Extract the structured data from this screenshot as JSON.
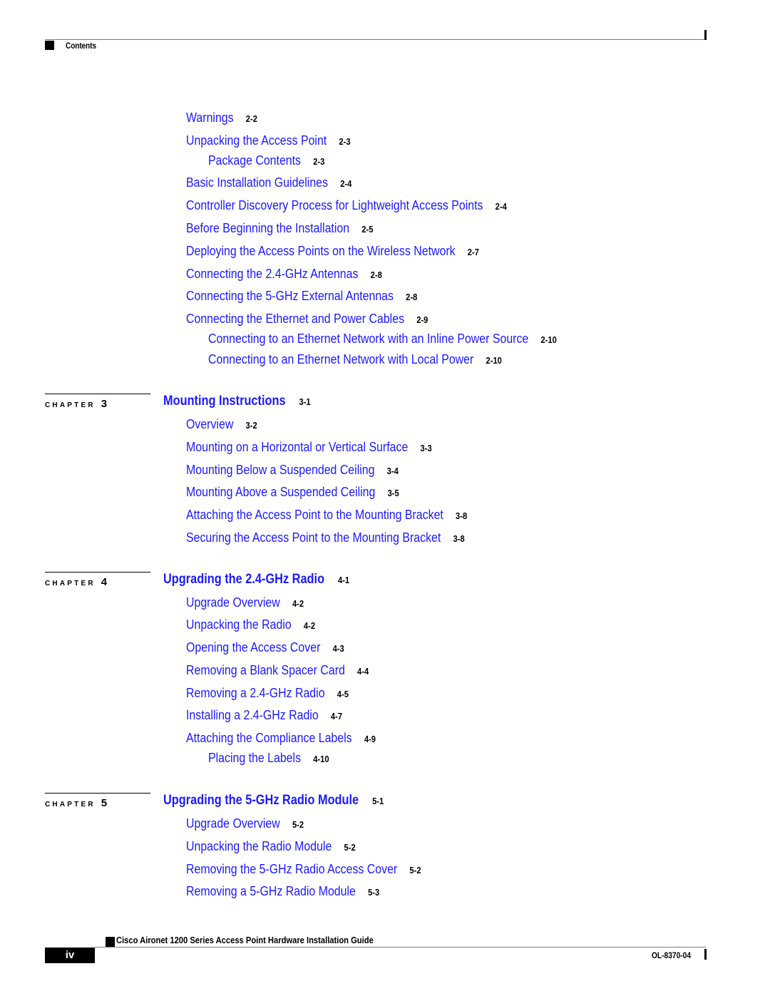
{
  "header": {
    "label": "Contents"
  },
  "toc": {
    "chapter2_cont": [
      {
        "title": "Warnings",
        "page": "2-2",
        "level": 1
      },
      {
        "title": "Unpacking the Access Point",
        "page": "2-3",
        "level": 1
      },
      {
        "title": "Package Contents",
        "page": "2-3",
        "level": 2
      },
      {
        "title": "Basic Installation Guidelines",
        "page": "2-4",
        "level": 1
      },
      {
        "title": "Controller Discovery Process for Lightweight Access Points",
        "page": "2-4",
        "level": 1
      },
      {
        "title": "Before Beginning the Installation",
        "page": "2-5",
        "level": 1
      },
      {
        "title": "Deploying the Access Points on the Wireless Network",
        "page": "2-7",
        "level": 1
      },
      {
        "title": "Connecting the 2.4-GHz Antennas",
        "page": "2-8",
        "level": 1
      },
      {
        "title": "Connecting the 5-GHz External Antennas",
        "page": "2-8",
        "level": 1
      },
      {
        "title": "Connecting the Ethernet and Power Cables",
        "page": "2-9",
        "level": 1
      },
      {
        "title": "Connecting to an Ethernet Network with an Inline Power Source",
        "page": "2-10",
        "level": 2
      },
      {
        "title": "Connecting to an Ethernet Network with Local Power",
        "page": "2-10",
        "level": 2
      }
    ],
    "chapters": [
      {
        "label": "CHAPTER",
        "number": "3",
        "title": "Mounting Instructions",
        "page": "3-1",
        "entries": [
          {
            "title": "Overview",
            "page": "3-2",
            "level": 1
          },
          {
            "title": "Mounting on a Horizontal or Vertical Surface",
            "page": "3-3",
            "level": 1
          },
          {
            "title": "Mounting Below a Suspended Ceiling",
            "page": "3-4",
            "level": 1
          },
          {
            "title": "Mounting Above a Suspended Ceiling",
            "page": "3-5",
            "level": 1
          },
          {
            "title": "Attaching the Access Point to the Mounting Bracket",
            "page": "3-8",
            "level": 1
          },
          {
            "title": "Securing the Access Point to the Mounting Bracket",
            "page": "3-8",
            "level": 1
          }
        ]
      },
      {
        "label": "CHAPTER",
        "number": "4",
        "title": "Upgrading the 2.4-GHz Radio",
        "page": "4-1",
        "entries": [
          {
            "title": "Upgrade Overview",
            "page": "4-2",
            "level": 1
          },
          {
            "title": "Unpacking the Radio",
            "page": "4-2",
            "level": 1
          },
          {
            "title": "Opening the Access Cover",
            "page": "4-3",
            "level": 1
          },
          {
            "title": "Removing a Blank Spacer Card",
            "page": "4-4",
            "level": 1
          },
          {
            "title": "Removing a 2.4-GHz Radio",
            "page": "4-5",
            "level": 1
          },
          {
            "title": "Installing a 2.4-GHz Radio",
            "page": "4-7",
            "level": 1
          },
          {
            "title": "Attaching the Compliance Labels",
            "page": "4-9",
            "level": 1
          },
          {
            "title": "Placing the Labels",
            "page": "4-10",
            "level": 2
          }
        ]
      },
      {
        "label": "CHAPTER",
        "number": "5",
        "title": "Upgrading the 5-GHz Radio Module",
        "page": "5-1",
        "entries": [
          {
            "title": "Upgrade Overview",
            "page": "5-2",
            "level": 1
          },
          {
            "title": "Unpacking the Radio Module",
            "page": "5-2",
            "level": 1
          },
          {
            "title": "Removing the 5-GHz Radio Access Cover",
            "page": "5-2",
            "level": 1
          },
          {
            "title": "Removing a 5-GHz Radio Module",
            "page": "5-3",
            "level": 1
          }
        ]
      }
    ]
  },
  "footer": {
    "book_title": "Cisco Aironet 1200 Series Access Point Hardware Installation Guide",
    "page_number": "iv",
    "doc_number": "OL-8370-04"
  },
  "colors": {
    "link": "#1a1aff",
    "text": "#000000"
  }
}
